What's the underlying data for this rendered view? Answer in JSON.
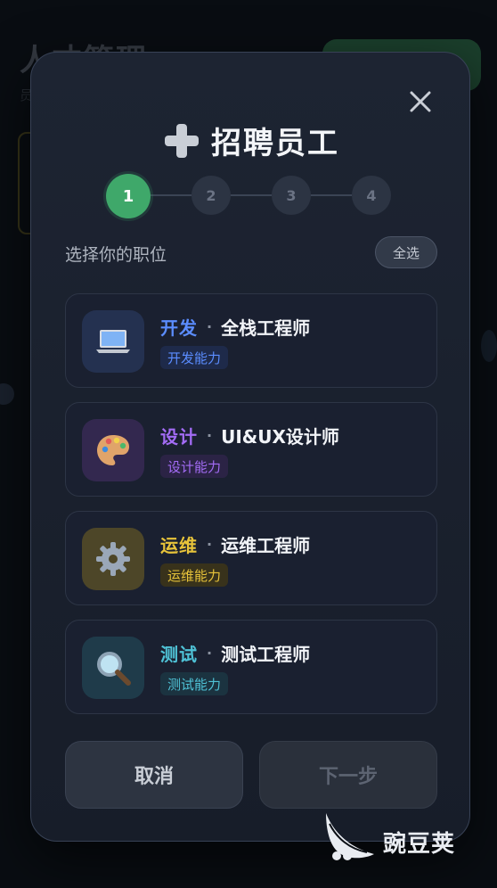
{
  "background": {
    "title": "人才管理",
    "subtitle": "员"
  },
  "modal": {
    "title": "招聘员工",
    "steps": [
      "1",
      "2",
      "3",
      "4"
    ],
    "active_step": 1,
    "section_label": "选择你的职位",
    "select_all_label": "全选",
    "roles": [
      {
        "category": "开发",
        "name": "全栈工程师",
        "tag": "开发能力",
        "icon": "laptop-icon",
        "accent": "#5b8dff",
        "tag_bg": "#1e2a4a",
        "icon_bg": "#243150"
      },
      {
        "category": "设计",
        "name": "UI&UX设计师",
        "tag": "设计能力",
        "icon": "palette-icon",
        "accent": "#a36cf5",
        "tag_bg": "#2b2345",
        "icon_bg": "#33284f"
      },
      {
        "category": "运维",
        "name": "运维工程师",
        "tag": "运维能力",
        "icon": "gear-icon",
        "accent": "#e8c43a",
        "tag_bg": "#38321b",
        "icon_bg": "#4d4628"
      },
      {
        "category": "测试",
        "name": "测试工程师",
        "tag": "测试能力",
        "icon": "magnifier-icon",
        "accent": "#4fc2d6",
        "tag_bg": "#1b3340",
        "icon_bg": "#1f3b4a"
      }
    ],
    "cancel_label": "取消",
    "next_label": "下一步"
  },
  "watermark": {
    "text": "豌豆荚"
  }
}
